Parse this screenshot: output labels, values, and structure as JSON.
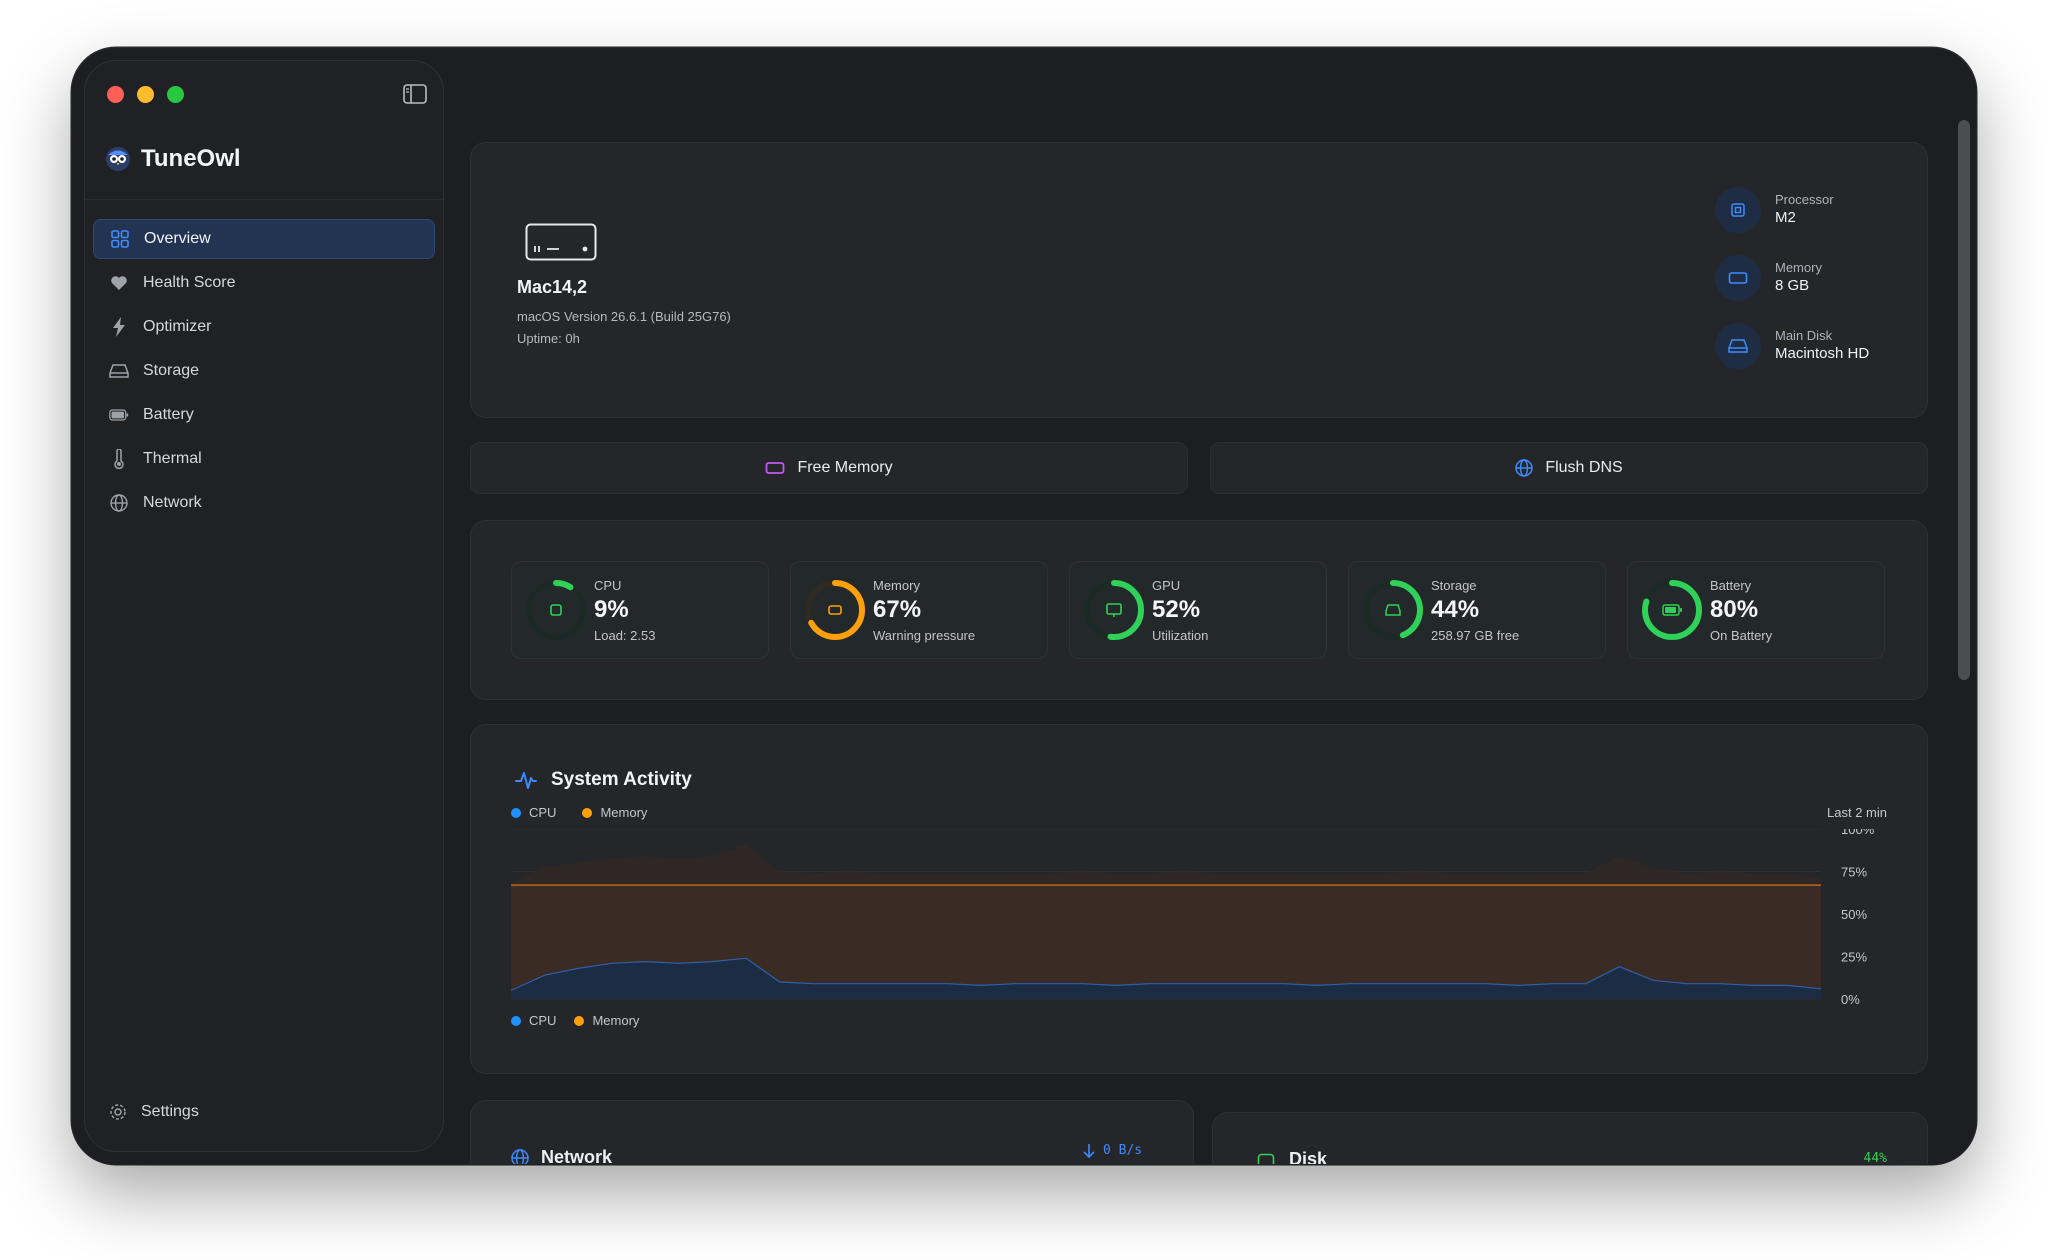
{
  "app": {
    "name": "TuneOwl"
  },
  "sidebar": {
    "items": [
      {
        "label": "Overview",
        "icon": "grid-icon",
        "active": true
      },
      {
        "label": "Health Score",
        "icon": "heart-icon"
      },
      {
        "label": "Optimizer",
        "icon": "bolt-icon"
      },
      {
        "label": "Storage",
        "icon": "drive-icon"
      },
      {
        "label": "Battery",
        "icon": "battery-icon"
      },
      {
        "label": "Thermal",
        "icon": "thermometer-icon"
      },
      {
        "label": "Network",
        "icon": "globe-icon"
      }
    ],
    "settings_label": "Settings"
  },
  "system": {
    "model": "Mac14,2",
    "os_version": "macOS Version 26.6.1 (Build 25G76)",
    "uptime": "Uptime: 0h",
    "specs": [
      {
        "label": "Processor",
        "value": "M2",
        "icon": "cpu-icon"
      },
      {
        "label": "Memory",
        "value": "8 GB",
        "icon": "memory-icon"
      },
      {
        "label": "Main Disk",
        "value": "Macintosh HD",
        "icon": "disk-icon"
      }
    ]
  },
  "actions": {
    "free_memory": "Free Memory",
    "flush_dns": "Flush DNS"
  },
  "metrics": [
    {
      "label": "CPU",
      "value": "9%",
      "sub": "Load: 2.53",
      "fraction": 0.09,
      "color": "#30d158"
    },
    {
      "label": "Memory",
      "value": "67%",
      "sub": "Warning pressure",
      "fraction": 0.67,
      "color": "#ff9f0a"
    },
    {
      "label": "GPU",
      "value": "52%",
      "sub": "Utilization",
      "fraction": 0.52,
      "color": "#30d158"
    },
    {
      "label": "Storage",
      "value": "44%",
      "sub": "258.97 GB free",
      "fraction": 0.44,
      "color": "#30d158"
    },
    {
      "label": "Battery",
      "value": "80%",
      "sub": "On Battery",
      "fraction": 0.8,
      "color": "#30d158"
    }
  ],
  "activity": {
    "title": "System Activity",
    "range_label": "Last 2 min",
    "legend": [
      {
        "name": "CPU",
        "color": "#1e90ff"
      },
      {
        "name": "Memory",
        "color": "#ff9f0a"
      }
    ],
    "y_ticks": [
      "100%",
      "75%",
      "50%",
      "25%",
      "0%"
    ]
  },
  "chart_data": {
    "type": "area",
    "ylim": [
      0,
      100
    ],
    "y_ticks": [
      "100%",
      "75%",
      "50%",
      "25%",
      "0%"
    ],
    "x_range_label": "Last 2 min",
    "series": [
      {
        "name": "Memory",
        "color": "#ff9f0a",
        "values": [
          67,
          67,
          67,
          67,
          67,
          67,
          67,
          67,
          67,
          67,
          67,
          67,
          67,
          67,
          67,
          67,
          67,
          67,
          67,
          67,
          67,
          67,
          67,
          67,
          67,
          67,
          67,
          67,
          67,
          67,
          67,
          67,
          67,
          67,
          67,
          67,
          67,
          67,
          67,
          67
        ]
      },
      {
        "name": "CPU",
        "color": "#1e90ff",
        "values": [
          5,
          14,
          18,
          21,
          22,
          21,
          22,
          24,
          10,
          9,
          9,
          9,
          9,
          9,
          8,
          9,
          9,
          9,
          8,
          9,
          9,
          9,
          9,
          9,
          8,
          9,
          9,
          9,
          9,
          9,
          8,
          9,
          9,
          19,
          11,
          9,
          9,
          8,
          8,
          6
        ]
      }
    ],
    "overlay": [
      68,
      78,
      80,
      83,
      84,
      83,
      84,
      91,
      75,
      74,
      75,
      74,
      74,
      74,
      73,
      74,
      74,
      75,
      74,
      74,
      75,
      74,
      74,
      74,
      73,
      74,
      74,
      75,
      74,
      74,
      73,
      74,
      74,
      84,
      77,
      74,
      75,
      74,
      74,
      71
    ]
  },
  "bottom": {
    "network_title": "Network",
    "network_rate": "0 B/s",
    "disk_title": "Disk",
    "disk_rate": "44%"
  }
}
